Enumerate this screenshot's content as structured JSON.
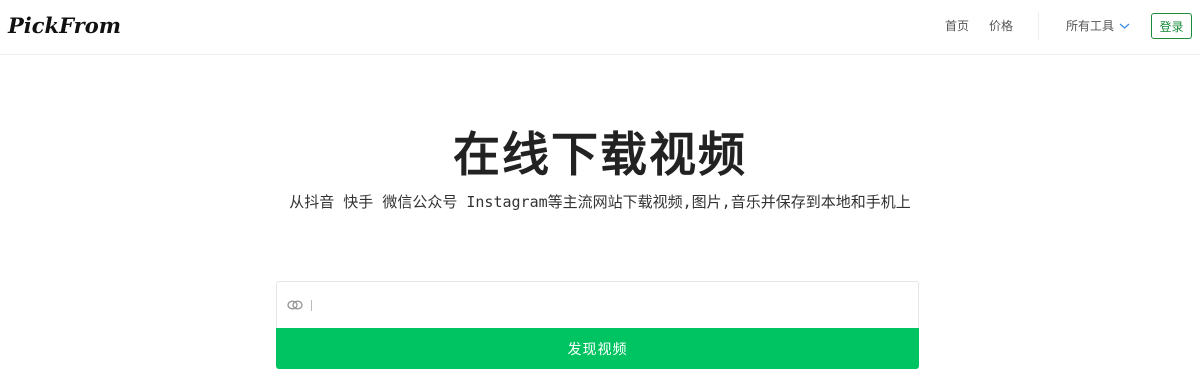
{
  "header": {
    "logo_text": "PickFrom",
    "nav": {
      "home": "首页",
      "price": "价格",
      "tools": "所有工具"
    },
    "login_label": "登录"
  },
  "hero": {
    "title": "在线下载视频",
    "subtitle": "从抖音 快手 微信公众号 Instagram等主流网站下载视频,图片,音乐并保存到本地和手机上"
  },
  "search": {
    "value": "",
    "placeholder": "",
    "icon": "link-icon",
    "button_label": "发现视频"
  },
  "colors": {
    "accent": "#00c462",
    "login_border": "#1a8c3a",
    "chevron": "#3a8ee6"
  }
}
